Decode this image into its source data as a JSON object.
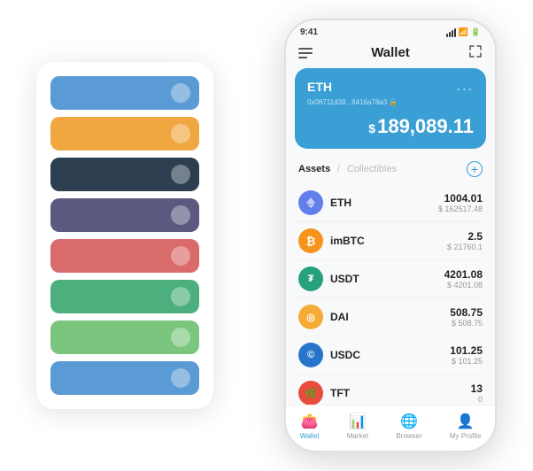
{
  "statusBar": {
    "time": "9:41",
    "batteryIcon": "▮"
  },
  "header": {
    "title": "Wallet",
    "menuIcon": "≡",
    "expandIcon": "⛶"
  },
  "walletCard": {
    "coin": "ETH",
    "address": "0x08711d38...8416a78a3",
    "addressSuffix": "🔒",
    "dots": "...",
    "balancePrefix": "$",
    "balance": "189,089.11"
  },
  "assetsSection": {
    "activeTab": "Assets",
    "separator": "/",
    "inactiveTab": "Collectibles",
    "addIcon": "+"
  },
  "assets": [
    {
      "symbol": "ETH",
      "iconClass": "eth",
      "iconText": "◆",
      "amount": "1004.01",
      "usd": "$ 162517.48"
    },
    {
      "symbol": "imBTC",
      "iconClass": "imbtc",
      "iconText": "₿",
      "amount": "2.5",
      "usd": "$ 21760.1"
    },
    {
      "symbol": "USDT",
      "iconClass": "usdt",
      "iconText": "₮",
      "amount": "4201.08",
      "usd": "$ 4201.08"
    },
    {
      "symbol": "DAI",
      "iconClass": "dai",
      "iconText": "◎",
      "amount": "508.75",
      "usd": "$ 508.75"
    },
    {
      "symbol": "USDC",
      "iconClass": "usdc",
      "iconText": "©",
      "amount": "101.25",
      "usd": "$ 101.25"
    },
    {
      "symbol": "TFT",
      "iconClass": "tft",
      "iconText": "🌿",
      "amount": "13",
      "usd": "0"
    }
  ],
  "bottomNav": [
    {
      "label": "Wallet",
      "active": true,
      "icon": "👛"
    },
    {
      "label": "Market",
      "active": false,
      "icon": "📊"
    },
    {
      "label": "Browser",
      "active": false,
      "icon": "🌐"
    },
    {
      "label": "My Profile",
      "active": false,
      "icon": "👤"
    }
  ],
  "cardStack": [
    {
      "colorClass": "blue"
    },
    {
      "colorClass": "orange"
    },
    {
      "colorClass": "dark"
    },
    {
      "colorClass": "purple"
    },
    {
      "colorClass": "red"
    },
    {
      "colorClass": "green"
    },
    {
      "colorClass": "light-green"
    },
    {
      "colorClass": "light-blue"
    }
  ]
}
